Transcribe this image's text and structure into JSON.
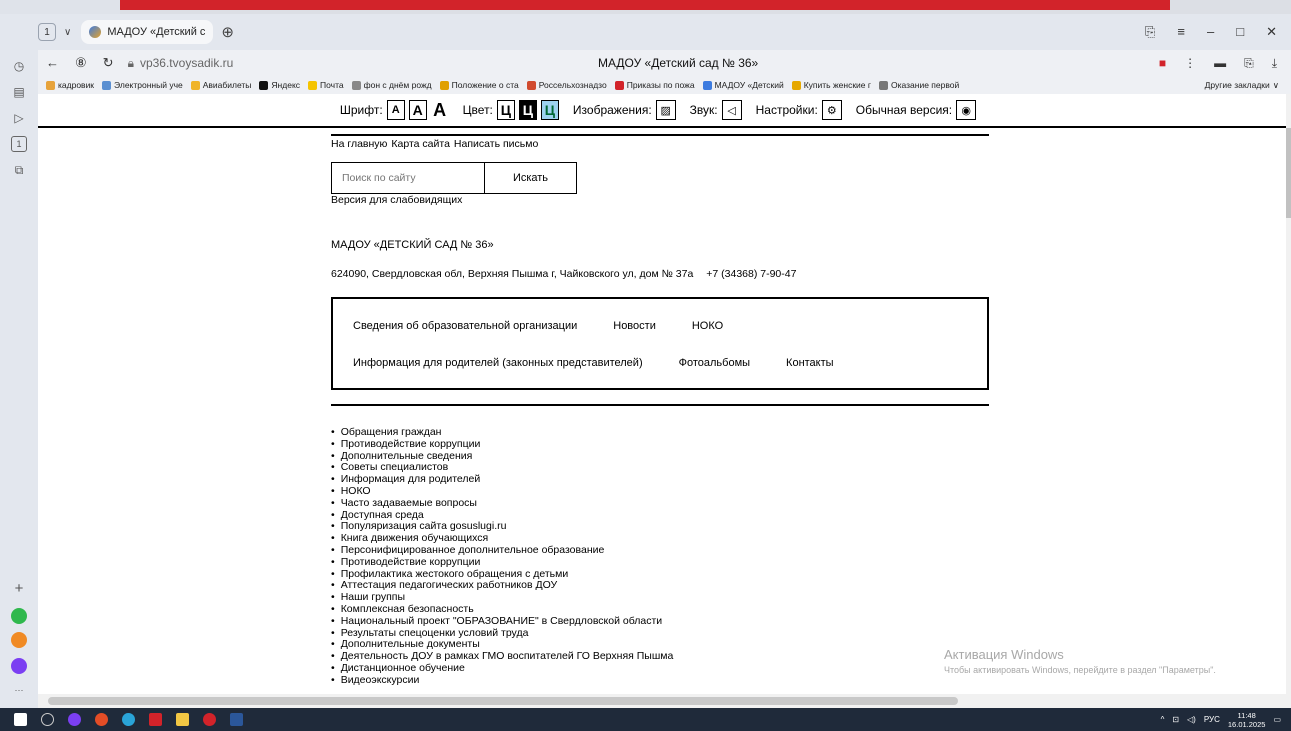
{
  "browser": {
    "tab_count": "1",
    "tab_title": "МАДОУ «Детский сад ×",
    "tab_close": "×",
    "url": "vp36.tvoysadik.ru",
    "page_title": "МАДОУ «Детский сад № 36»",
    "bookmarks": [
      {
        "label": "кадровик",
        "color": "#e7a33b"
      },
      {
        "label": "Электронный уче",
        "color": "#5a8fd1"
      },
      {
        "label": "Авиабилеты",
        "color": "#f0b429"
      },
      {
        "label": "Яндекс",
        "color": "#111111"
      },
      {
        "label": "Почта",
        "color": "#f5c400"
      },
      {
        "label": "фон с днём рожд",
        "color": "#888888"
      },
      {
        "label": "Положение о ста",
        "color": "#e0a000"
      },
      {
        "label": "Россельхознадзо",
        "color": "#d14b2f"
      },
      {
        "label": "Приказы по пожа",
        "color": "#d2232a"
      },
      {
        "label": "МАДОУ «Детский",
        "color": "#3c7be0"
      },
      {
        "label": "Купить женские г",
        "color": "#e6a800"
      },
      {
        "label": "Оказание первой",
        "color": "#777777"
      }
    ],
    "other_bookmarks": "Другие закладки"
  },
  "a11y": {
    "font_label": "Шрифт:",
    "font_a": "А",
    "color_label": "Цвет:",
    "color_c": "Ц",
    "images_label": "Изображения:",
    "sound_label": "Звук:",
    "settings_label": "Настройки:",
    "normal_label": "Обычная версия:"
  },
  "top_links": [
    "На главную",
    "Карта сайта",
    "Написать письмо"
  ],
  "search": {
    "placeholder": "Поиск по сайту",
    "button": "Искать"
  },
  "vision_link": "Версия для слабовидящих",
  "org": {
    "name": "МАДОУ «ДЕТСКИЙ САД № 36»",
    "address": "624090, Свердловская обл, Верхняя Пышма г, Чайковского ул, дом № 37а",
    "phone": "+7 (34368) 7-90-47"
  },
  "menu": {
    "row1": [
      "Сведения об образовательной организации",
      "Новости",
      "НОКО"
    ],
    "row2": [
      "Информация для родителей (законных представителей)",
      "Фотоальбомы",
      "Контакты"
    ]
  },
  "side_menu": [
    "Обращения граждан",
    "Противодействие коррупции",
    "Дополнительные сведения",
    "Советы специалистов",
    "Информация для родителей",
    "НОКО",
    "Часто задаваемые вопросы",
    "Доступная среда",
    "Популяризация сайта gosuslugi.ru",
    "Книга движения обучающихся",
    "Персонифицированное дополнительное образование",
    "Противодействие коррупции",
    "Профилактика жестокого обращения с детьми",
    "Аттестация педагогических работников ДОУ",
    "Наши группы",
    "Комплексная безопасность",
    "Национальный проект \"ОБРАЗОВАНИЕ\" в Свердловской области",
    "Результаты спецоценки условий труда",
    "Дополнительные документы",
    "Деятельность ДОУ в рамках ГМО воспитателей ГО Верхняя Пышма",
    "Дистанционное обучение",
    "Видеоэкскурсии"
  ],
  "watermark": {
    "title": "Активация Windows",
    "subtitle": "Чтобы активировать Windows, перейдите в раздел \"Параметры\"."
  },
  "taskbar": {
    "lang": "РУС",
    "time": "11:48",
    "date": "16.01.2025"
  },
  "colors": {
    "accent_red": "#d2232a",
    "contrast_blue": "#9dd1f0"
  }
}
